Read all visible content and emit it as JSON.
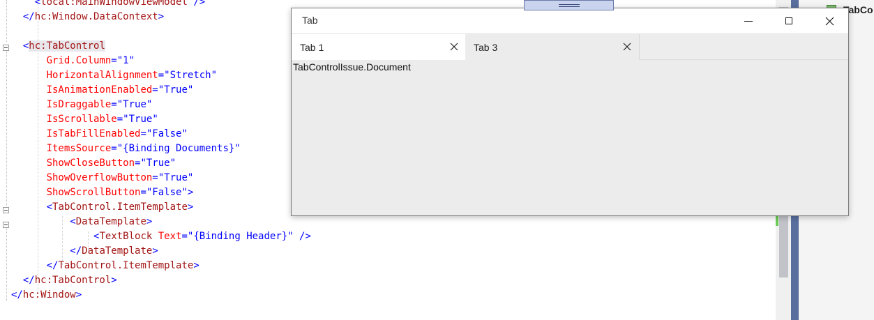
{
  "editor": {
    "lines": [
      [
        [
          "    ",
          ""
        ],
        [
          "<",
          "tg"
        ],
        [
          "local:MainWindowViewModel",
          "tn"
        ],
        [
          " />",
          "tg"
        ]
      ],
      [
        [
          "  ",
          ""
        ],
        [
          "</",
          "tg"
        ],
        [
          "hc:Window.DataContext",
          "tn"
        ],
        [
          ">",
          "tg"
        ]
      ],
      [
        [
          "",
          ""
        ]
      ],
      [
        [
          "  ",
          ""
        ],
        [
          "<",
          "tg"
        ],
        [
          "hc:TabControl",
          "tn hl"
        ]
      ],
      [
        [
          "      ",
          ""
        ],
        [
          "Grid.Column",
          "at"
        ],
        [
          "=",
          "tg"
        ],
        [
          "\"1\"",
          "vl"
        ]
      ],
      [
        [
          "      ",
          ""
        ],
        [
          "HorizontalAlignment",
          "at"
        ],
        [
          "=",
          "tg"
        ],
        [
          "\"Stretch\"",
          "vl"
        ]
      ],
      [
        [
          "      ",
          ""
        ],
        [
          "IsAnimationEnabled",
          "at"
        ],
        [
          "=",
          "tg"
        ],
        [
          "\"True\"",
          "vl"
        ]
      ],
      [
        [
          "      ",
          ""
        ],
        [
          "IsDraggable",
          "at"
        ],
        [
          "=",
          "tg"
        ],
        [
          "\"True\"",
          "vl"
        ]
      ],
      [
        [
          "      ",
          ""
        ],
        [
          "IsScrollable",
          "at"
        ],
        [
          "=",
          "tg"
        ],
        [
          "\"True\"",
          "vl"
        ]
      ],
      [
        [
          "      ",
          ""
        ],
        [
          "IsTabFillEnabled",
          "at"
        ],
        [
          "=",
          "tg"
        ],
        [
          "\"False\"",
          "vl"
        ]
      ],
      [
        [
          "      ",
          ""
        ],
        [
          "ItemsSource",
          "at"
        ],
        [
          "=",
          "tg"
        ],
        [
          "\"{Binding Documents}\"",
          "vl"
        ]
      ],
      [
        [
          "      ",
          ""
        ],
        [
          "ShowCloseButton",
          "at"
        ],
        [
          "=",
          "tg"
        ],
        [
          "\"True\"",
          "vl"
        ]
      ],
      [
        [
          "      ",
          ""
        ],
        [
          "ShowOverflowButton",
          "at"
        ],
        [
          "=",
          "tg"
        ],
        [
          "\"True\"",
          "vl"
        ]
      ],
      [
        [
          "      ",
          ""
        ],
        [
          "ShowScrollButton",
          "at"
        ],
        [
          "=",
          "tg"
        ],
        [
          "\"False\"",
          "vl"
        ],
        [
          ">",
          "tg"
        ]
      ],
      [
        [
          "      ",
          ""
        ],
        [
          "<",
          "tg"
        ],
        [
          "TabControl.ItemTemplate",
          "tn"
        ],
        [
          ">",
          "tg"
        ]
      ],
      [
        [
          "          ",
          ""
        ],
        [
          "<",
          "tg"
        ],
        [
          "DataTemplate",
          "tn"
        ],
        [
          ">",
          "tg"
        ]
      ],
      [
        [
          "              ",
          ""
        ],
        [
          "<",
          "tg"
        ],
        [
          "TextBlock",
          "tn"
        ],
        [
          " ",
          ""
        ],
        [
          "Text",
          "at"
        ],
        [
          "=",
          "tg"
        ],
        [
          "\"{Binding Header}\"",
          "vl"
        ],
        [
          " />",
          "tg"
        ]
      ],
      [
        [
          "          ",
          ""
        ],
        [
          "</",
          "tg"
        ],
        [
          "DataTemplate",
          "tn"
        ],
        [
          ">",
          "tg"
        ]
      ],
      [
        [
          "      ",
          ""
        ],
        [
          "</",
          "tg"
        ],
        [
          "TabControl.ItemTemplate",
          "tn"
        ],
        [
          ">",
          "tg"
        ]
      ],
      [
        [
          "  ",
          ""
        ],
        [
          "</",
          "tg"
        ],
        [
          "hc:TabControl",
          "tn"
        ],
        [
          ">",
          "tg"
        ]
      ],
      [
        [
          "",
          ""
        ],
        [
          "</",
          "tg"
        ],
        [
          "hc:Window",
          "tn"
        ],
        [
          ">",
          "tg"
        ]
      ]
    ]
  },
  "side_panel": {
    "label": "TabCo"
  },
  "window": {
    "title": "Tab",
    "tabs": [
      {
        "label": "Tab 1",
        "selected": true
      },
      {
        "label": "Tab 3",
        "selected": false
      }
    ],
    "content_text": "TabControlIssue.Document"
  },
  "colors": {
    "xml_tag": "#0000ff",
    "xml_name": "#a31515",
    "xml_attribute": "#ff0000",
    "xml_value": "#0000ff",
    "sidebar_accent": "#596f9e"
  }
}
